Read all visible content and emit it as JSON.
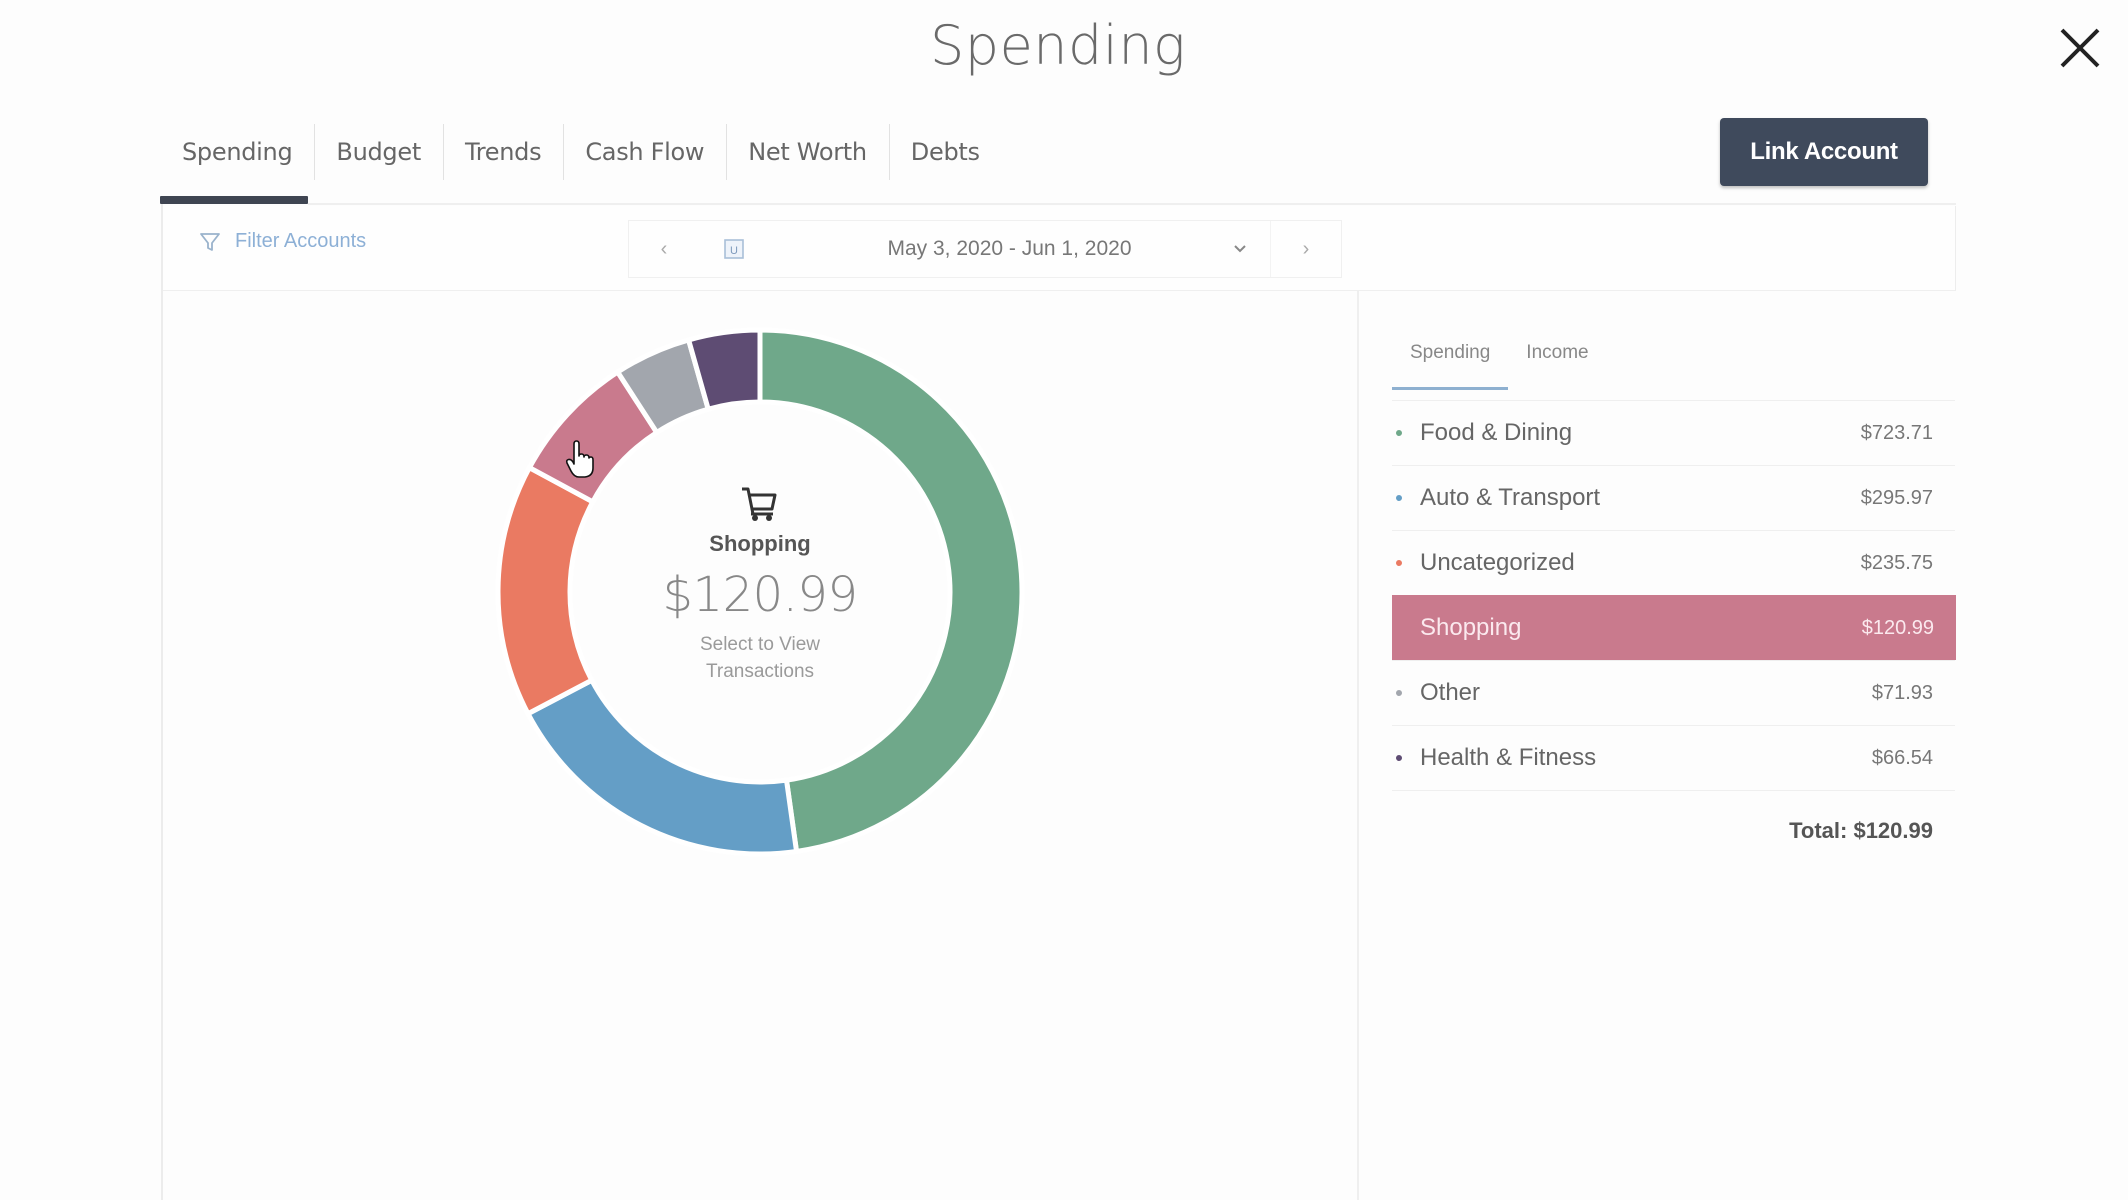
{
  "window": {
    "title": "Spending"
  },
  "tabs": [
    {
      "label": "Spending",
      "active": true
    },
    {
      "label": "Budget"
    },
    {
      "label": "Trends"
    },
    {
      "label": "Cash Flow"
    },
    {
      "label": "Net Worth"
    },
    {
      "label": "Debts"
    }
  ],
  "toolbar": {
    "link_account_label": "Link Account"
  },
  "filter": {
    "label": "Filter Accounts",
    "icon": "funnel-icon"
  },
  "date_range": {
    "label": "May 3, 2020 - Jun 1, 2020",
    "prev_icon": "chevron-left-icon",
    "calendar_icon": "calendar-icon",
    "dropdown_icon": "chevron-down-icon",
    "next_icon": "chevron-right-icon"
  },
  "center": {
    "icon": "shopping-cart-icon",
    "category": "Shopping",
    "amount": "$120.99",
    "hint_line1": "Select to View",
    "hint_line2": "Transactions"
  },
  "side_tabs": [
    {
      "label": "Spending",
      "active": true
    },
    {
      "label": "Income"
    }
  ],
  "categories": [
    {
      "label": "Food & Dining",
      "amount": "$723.71",
      "color": "#6fa88a"
    },
    {
      "label": "Auto & Transport",
      "amount": "$295.97",
      "color": "#649ec6"
    },
    {
      "label": "Uncategorized",
      "amount": "$235.75",
      "color": "#ea7a62"
    },
    {
      "label": "Shopping",
      "amount": "$120.99",
      "color": "#c97a8d",
      "selected": true
    },
    {
      "label": "Other",
      "amount": "$71.93",
      "color": "#a2a6ad"
    },
    {
      "label": "Health & Fitness",
      "amount": "$66.54",
      "color": "#5e4c73"
    }
  ],
  "total": "Total: $120.99",
  "chart_data": {
    "type": "pie",
    "title": "Spending",
    "categories": [
      "Food & Dining",
      "Auto & Transport",
      "Uncategorized",
      "Shopping",
      "Other",
      "Health & Fitness"
    ],
    "values": [
      723.71,
      295.97,
      235.75,
      120.99,
      71.93,
      66.54
    ],
    "colors": [
      "#6fa88a",
      "#649ec6",
      "#ea7a62",
      "#c97a8d",
      "#a2a6ad",
      "#5e4c73"
    ],
    "selected": "Shopping",
    "donut": true
  }
}
